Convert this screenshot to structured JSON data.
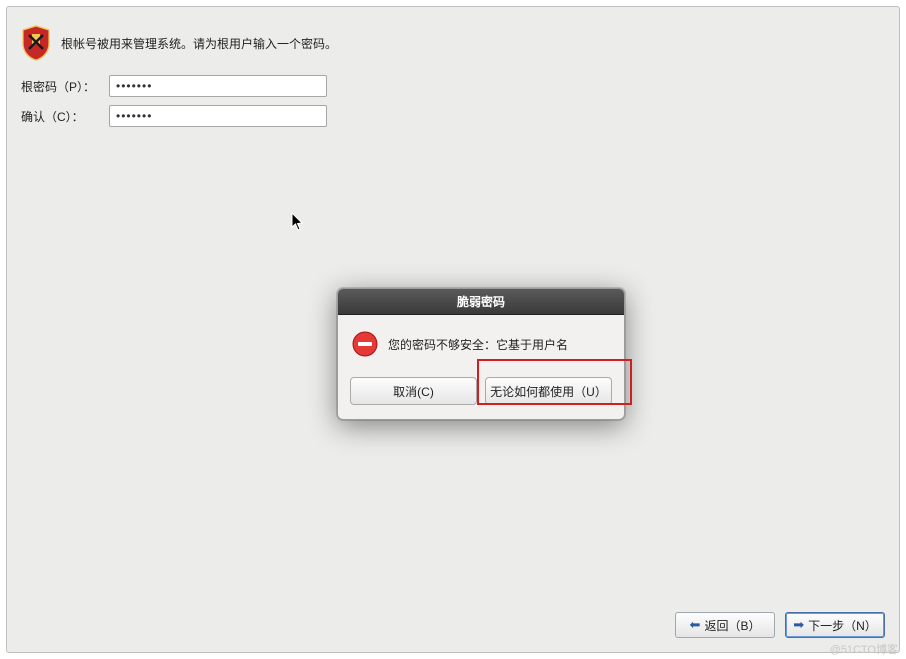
{
  "header": {
    "icon": "shield-icon",
    "text": "根帐号被用来管理系统。请为根用户输入一个密码。"
  },
  "form": {
    "password_label": "根密码（P）：",
    "password_value": "•••••••",
    "confirm_label": "确认（C）：",
    "confirm_value": "•••••••"
  },
  "dialog": {
    "title": "脆弱密码",
    "message": "您的密码不够安全：它基于用户名",
    "cancel_label": "取消(C)",
    "use_anyway_label": "无论如何都使用（U）"
  },
  "footer": {
    "back_label": "返回（B）",
    "next_label": "下一步（N）"
  },
  "watermark": "@51CTO博客"
}
